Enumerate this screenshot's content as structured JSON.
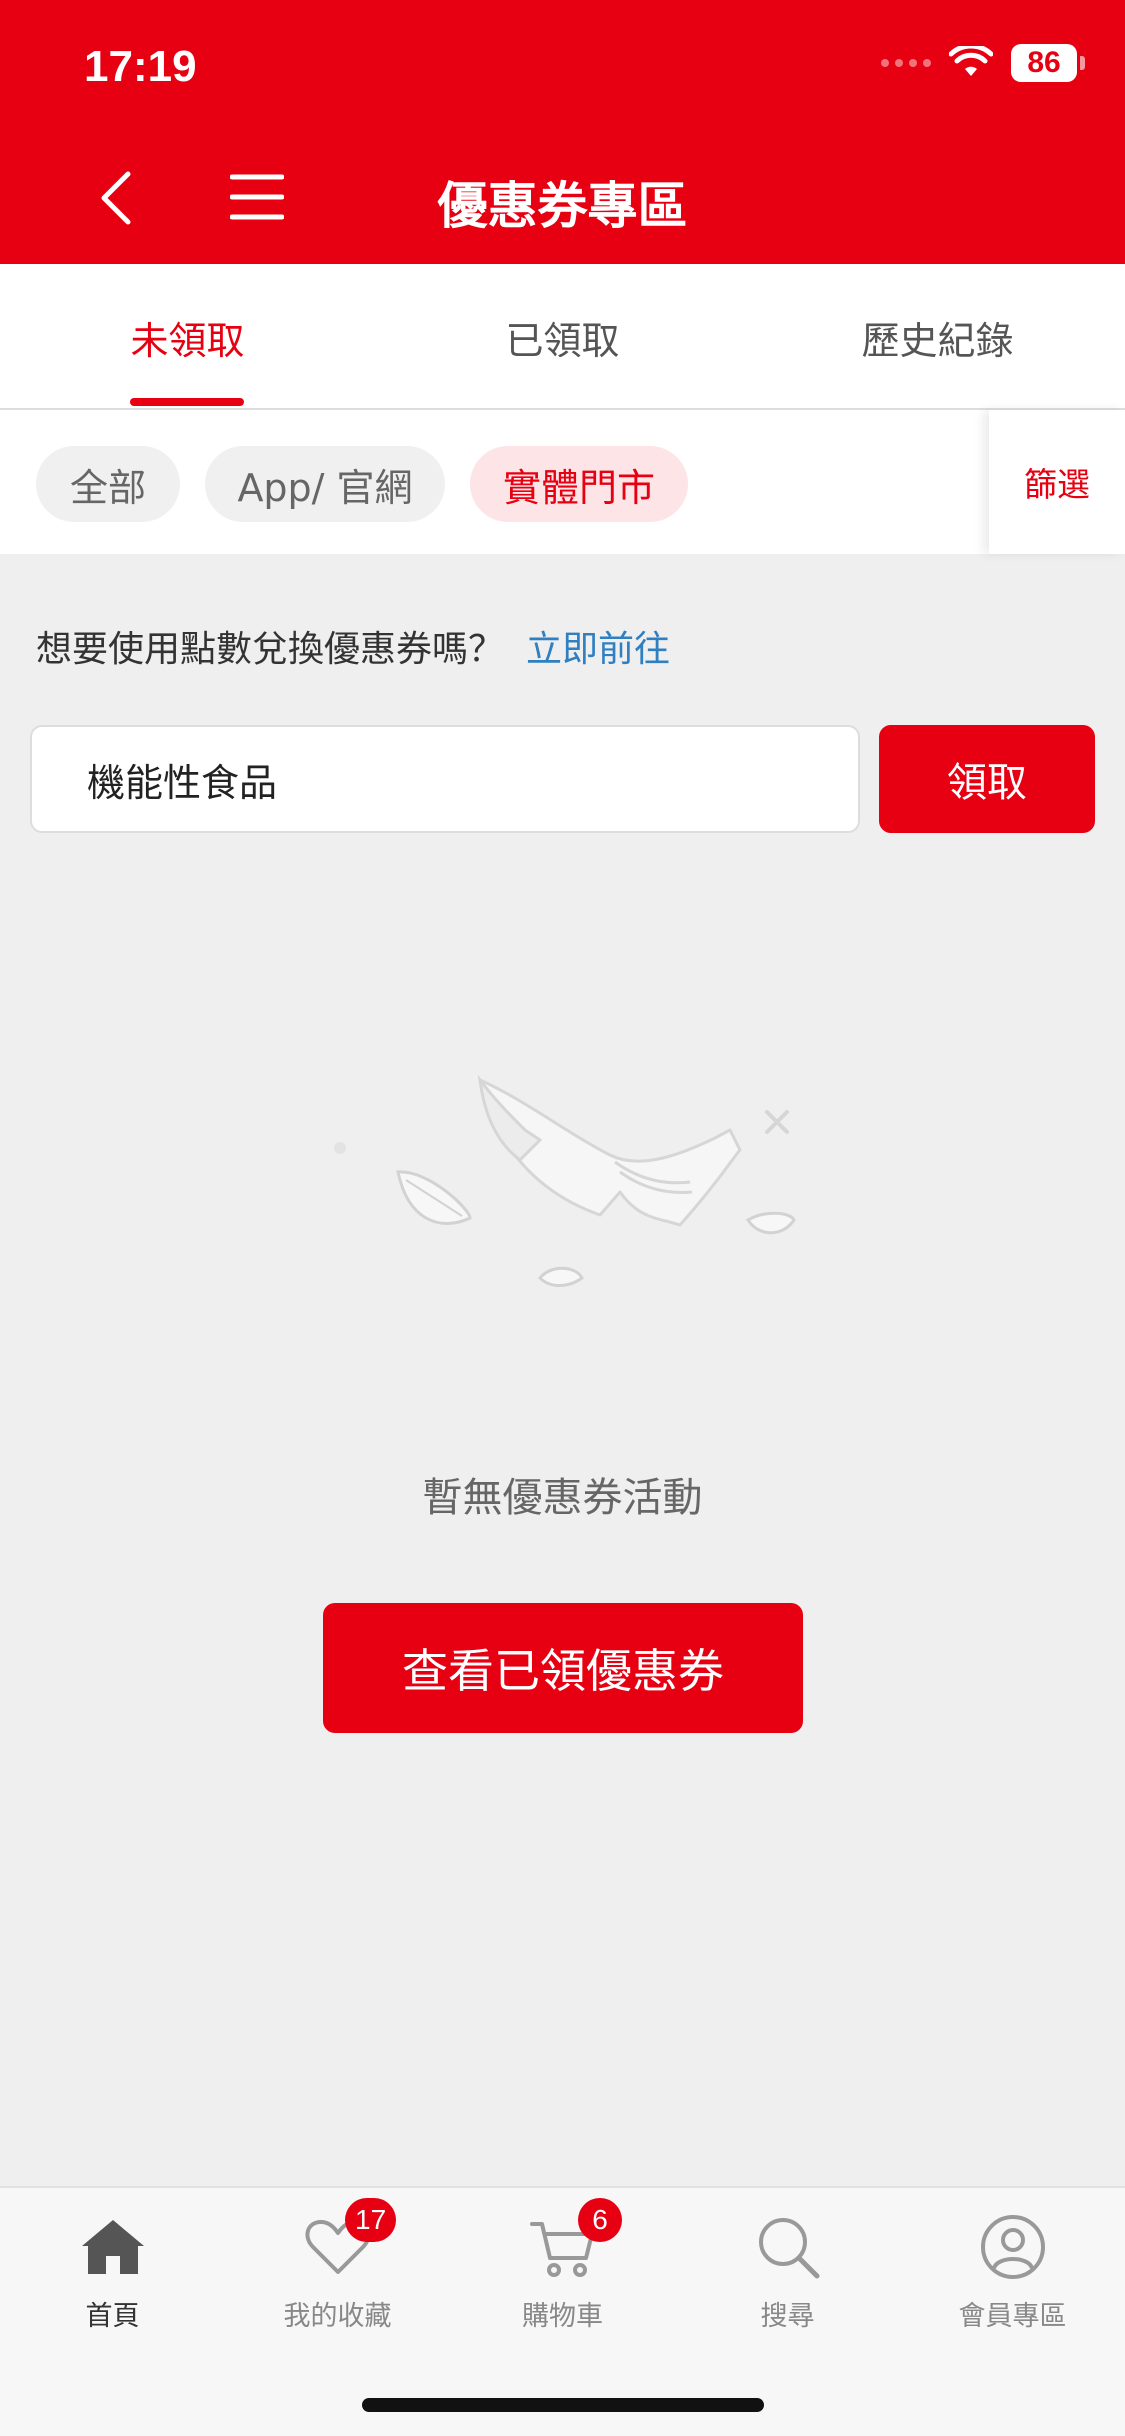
{
  "status_bar": {
    "time": "17:19",
    "battery": "86"
  },
  "header": {
    "title": "優惠券專區"
  },
  "tabs": [
    {
      "label": "未領取"
    },
    {
      "label": "已領取"
    },
    {
      "label": "歷史紀錄"
    }
  ],
  "active_tab": "未領取",
  "filters": {
    "chips": [
      {
        "label": "全部"
      },
      {
        "label": "App/ 官網"
      },
      {
        "label": "實體門市"
      }
    ],
    "active_chip": "實體門市",
    "filter_label": "篩選"
  },
  "points_prompt": {
    "text": "想要使用點數兌換優惠券嗎？",
    "link": "立即前往"
  },
  "coupon_code": {
    "value": "機能性食品",
    "claim_label": "領取"
  },
  "empty_state": {
    "message": "暫無優惠券活動",
    "button_label": "查看已領優惠券"
  },
  "bottom_nav": [
    {
      "label": "首頁",
      "icon": "home-icon"
    },
    {
      "label": "我的收藏",
      "icon": "heart-icon",
      "badge": "17"
    },
    {
      "label": "購物車",
      "icon": "cart-icon",
      "badge": "6"
    },
    {
      "label": "搜尋",
      "icon": "search-icon"
    },
    {
      "label": "會員專區",
      "icon": "user-icon"
    }
  ],
  "colors": {
    "brand_red": "#e60012",
    "link_blue": "#2f7fc1",
    "chip_active_bg": "#fde5e7"
  }
}
